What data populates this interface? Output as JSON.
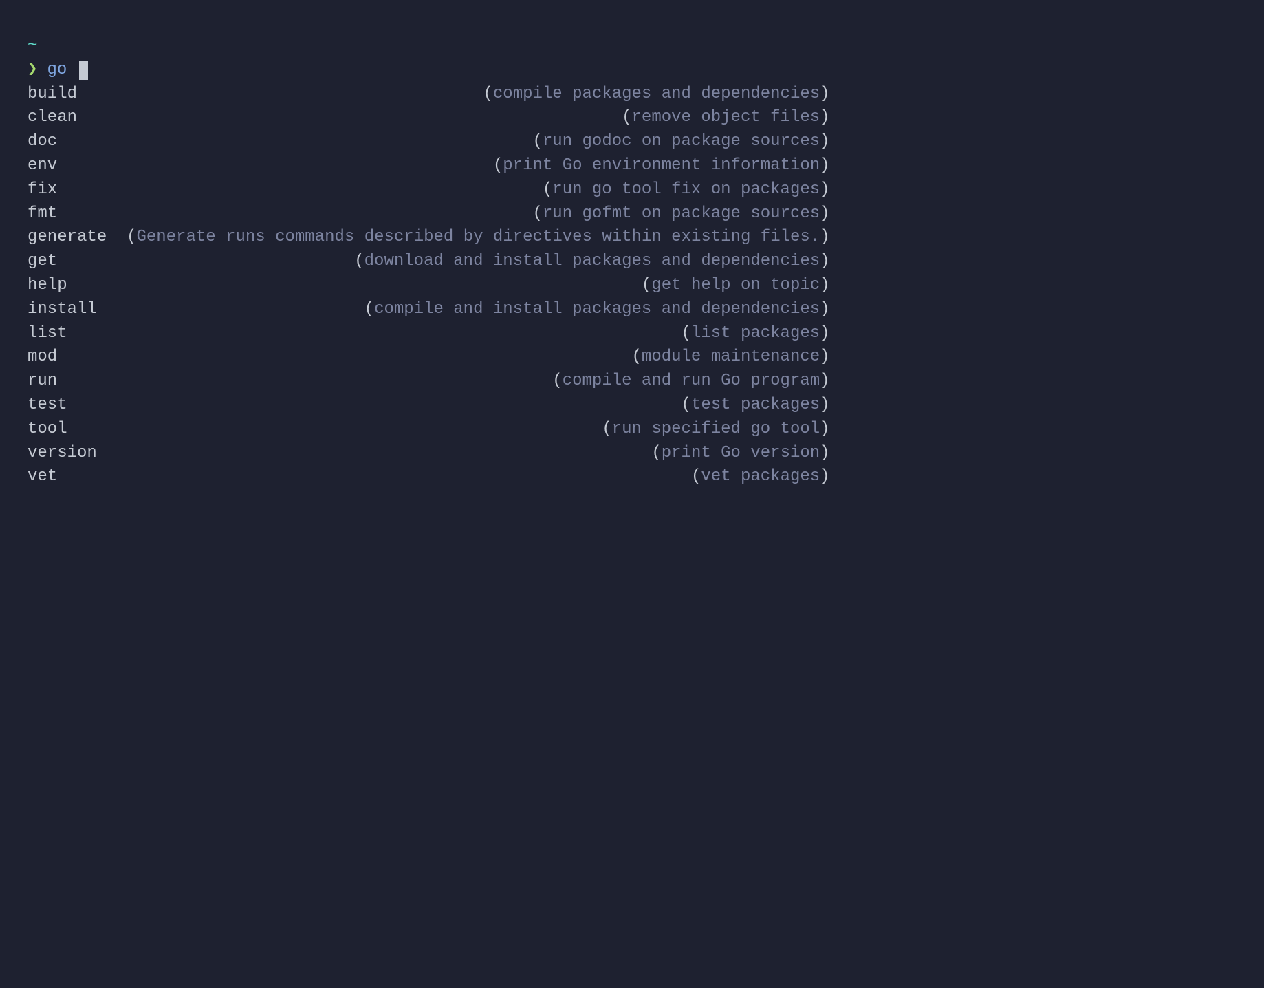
{
  "prompt": {
    "cwd": "~",
    "symbol": "❯",
    "command": "go"
  },
  "completions": [
    {
      "name": "build",
      "desc": "compile packages and dependencies"
    },
    {
      "name": "clean",
      "desc": "remove object files"
    },
    {
      "name": "doc",
      "desc": "run godoc on package sources"
    },
    {
      "name": "env",
      "desc": "print Go environment information"
    },
    {
      "name": "fix",
      "desc": "run go tool fix on packages"
    },
    {
      "name": "fmt",
      "desc": "run gofmt on package sources"
    },
    {
      "name": "generate",
      "desc": "Generate runs commands described by directives within existing files."
    },
    {
      "name": "get",
      "desc": "download and install packages and dependencies"
    },
    {
      "name": "help",
      "desc": "get help on topic"
    },
    {
      "name": "install",
      "desc": "compile and install packages and dependencies"
    },
    {
      "name": "list",
      "desc": "list packages"
    },
    {
      "name": "mod",
      "desc": "module maintenance"
    },
    {
      "name": "run",
      "desc": "compile and run Go program"
    },
    {
      "name": "test",
      "desc": "test packages"
    },
    {
      "name": "tool",
      "desc": "run specified go tool"
    },
    {
      "name": "version",
      "desc": "print Go version"
    },
    {
      "name": "vet",
      "desc": "vet packages"
    }
  ],
  "columns": {
    "name_width_ch": 10,
    "total_width_ch": 81
  }
}
